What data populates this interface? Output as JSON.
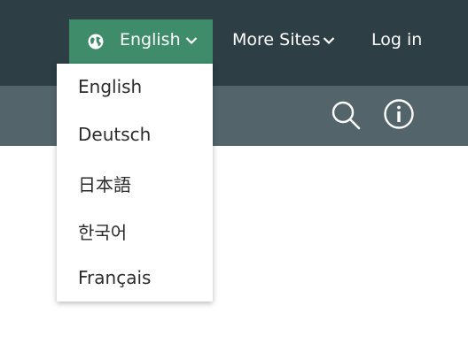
{
  "header": {
    "language_button": {
      "label": "English",
      "icon": "globe-icon",
      "caret_icon": "chevron-down-icon"
    },
    "more_sites": {
      "label": "More Sites",
      "caret_icon": "chevron-down-icon"
    },
    "login_label": "Log in"
  },
  "toolbar": {
    "search_icon": "search-icon",
    "info_icon": "info-icon"
  },
  "language_menu": {
    "items": [
      {
        "label": "English"
      },
      {
        "label": "Deutsch"
      },
      {
        "label": "日本語"
      },
      {
        "label": "한국어"
      },
      {
        "label": "Français"
      }
    ]
  },
  "colors": {
    "topbar": "#2d3e44",
    "subbar": "#53646a",
    "accent": "#3f8c6b",
    "menu_bg": "#ffffff",
    "menu_text": "#2b2b2b"
  }
}
